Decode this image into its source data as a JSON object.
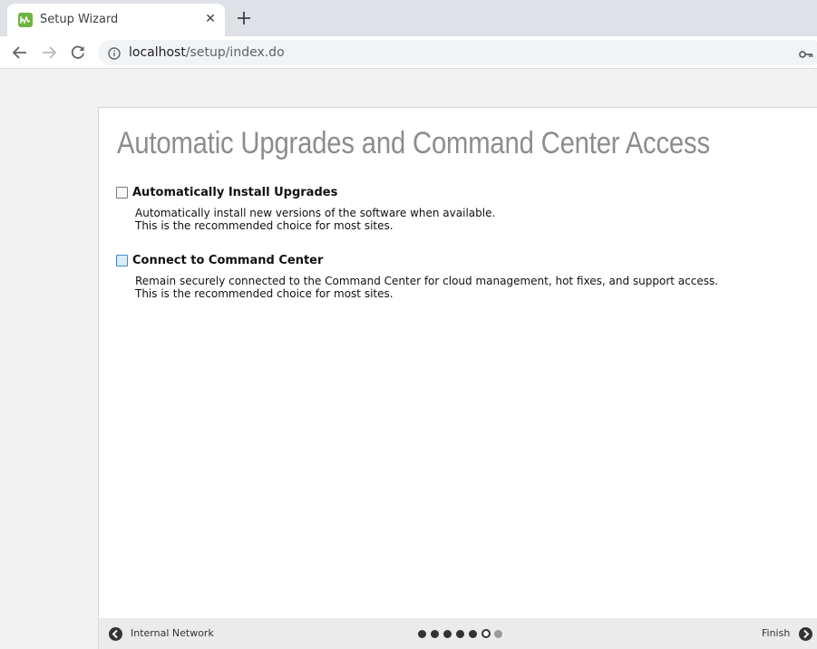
{
  "browser": {
    "tab_title": "Setup Wizard",
    "tab_close": "✕",
    "url_host": "localhost",
    "url_path": "/setup/index.do"
  },
  "page": {
    "title": "Automatic Upgrades and Command Center Access",
    "options": [
      {
        "label": "Automatically Install Upgrades",
        "checked": false,
        "desc_line1": "Automatically install new versions of the software when available.",
        "desc_line2": "This is the recommended choice for most sites."
      },
      {
        "label": "Connect to Command Center",
        "checked": false,
        "desc_line1": "Remain securely connected to the Command Center for cloud management, hot fixes, and support access.",
        "desc_line2": "This is the recommended choice for most sites."
      }
    ]
  },
  "footer": {
    "prev_label": "Internal Network",
    "next_label": "Finish",
    "steps_total": 7,
    "current_step": 6
  },
  "colors": {
    "favicon": "#6cb33f",
    "title_gray": "#8d8d8d",
    "footer_bg": "#ebebeb"
  }
}
